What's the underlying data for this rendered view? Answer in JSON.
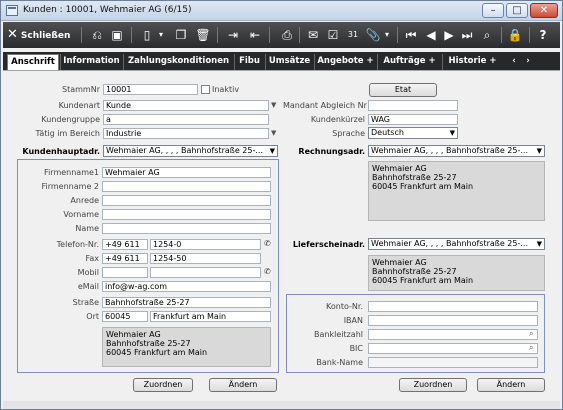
{
  "window": {
    "title": "Kunden : 10001, Wehmaier AG (6/15)"
  },
  "toolbar": {
    "close_label": "Schließen"
  },
  "tabs": [
    {
      "label": "Anschrift"
    },
    {
      "label": "Information"
    },
    {
      "label": "Zahlungskonditionen"
    },
    {
      "label": "Fibu"
    },
    {
      "label": "Umsätze"
    },
    {
      "label": "Angebote +"
    },
    {
      "label": "Aufträge +"
    },
    {
      "label": "Historie +"
    }
  ],
  "general": {
    "stammnr_label": "StammNr",
    "stammnr": "10001",
    "inaktiv_label": "Inaktiv",
    "etat_button": "Etat",
    "kundenart_label": "Kundenart",
    "kundenart": "Kunde",
    "mandant_label": "Mandant Abgleich Nr",
    "kundengruppe_label": "Kundengruppe",
    "kundengruppe": "a",
    "kundenkuerzel_label": "Kundenkürzel",
    "kundenkuerzel": "WAG",
    "bereich_label": "Tätig im Bereich",
    "bereich": "Industrie",
    "sprache_label": "Sprache",
    "sprache": "Deutsch"
  },
  "hauptadr": {
    "label": "Kundenhauptadr.",
    "select": "Wehmaier AG, , , , Bahnhofstraße 25-...",
    "firmenname1_label": "Firmenname1",
    "firmenname1": "Wehmaier AG",
    "firmenname2_label": "Firmenname 2",
    "anrede_label": "Anrede",
    "vorname_label": "Vorname",
    "name_label": "Name",
    "telefon_label": "Telefon-Nr.",
    "telefon_vorwahl": "+49 611",
    "telefon_nr": "1254-0",
    "fax_label": "Fax",
    "fax_vorwahl": "+49 611",
    "fax_nr": "1254-50",
    "mobil_label": "Mobil",
    "email_label": "eMail",
    "email": "info@w-ag.com",
    "strasse_label": "Straße",
    "strasse": "Bahnhofstraße 25-27",
    "ort_label": "Ort",
    "plz": "60045",
    "ort": "Frankfurt am Main",
    "summary": "Wehmaier AG\nBahnhofstraße 25-27\n60045 Frankfurt am Main",
    "zuordnen": "Zuordnen",
    "aendern": "Ändern"
  },
  "rechnungsadr": {
    "label": "Rechnungsadr.",
    "select": "Wehmaier AG, , , , Bahnhofstraße 25-...",
    "summary": "Wehmaier AG\nBahnhofstraße 25-27\n60045 Frankfurt am Main"
  },
  "lieferadr": {
    "label": "Lieferscheinadr.",
    "select": "Wehmaier AG, , , , Bahnhofstraße 25-...",
    "summary": "Wehmaier AG\nBahnhofstraße 25-27\n60045 Frankfurt am Main"
  },
  "bank": {
    "konto_label": "Konto-Nr.",
    "iban_label": "IBAN",
    "blz_label": "Bankleitzahl",
    "bic_label": "BIC",
    "bankname_label": "Bank-Name",
    "zuordnen": "Zuordnen",
    "aendern": "Ändern"
  },
  "colors": {
    "panel_border": "#7f90c0",
    "toolbar": "#2e2f30",
    "titlebar": "#c4d3e6"
  }
}
